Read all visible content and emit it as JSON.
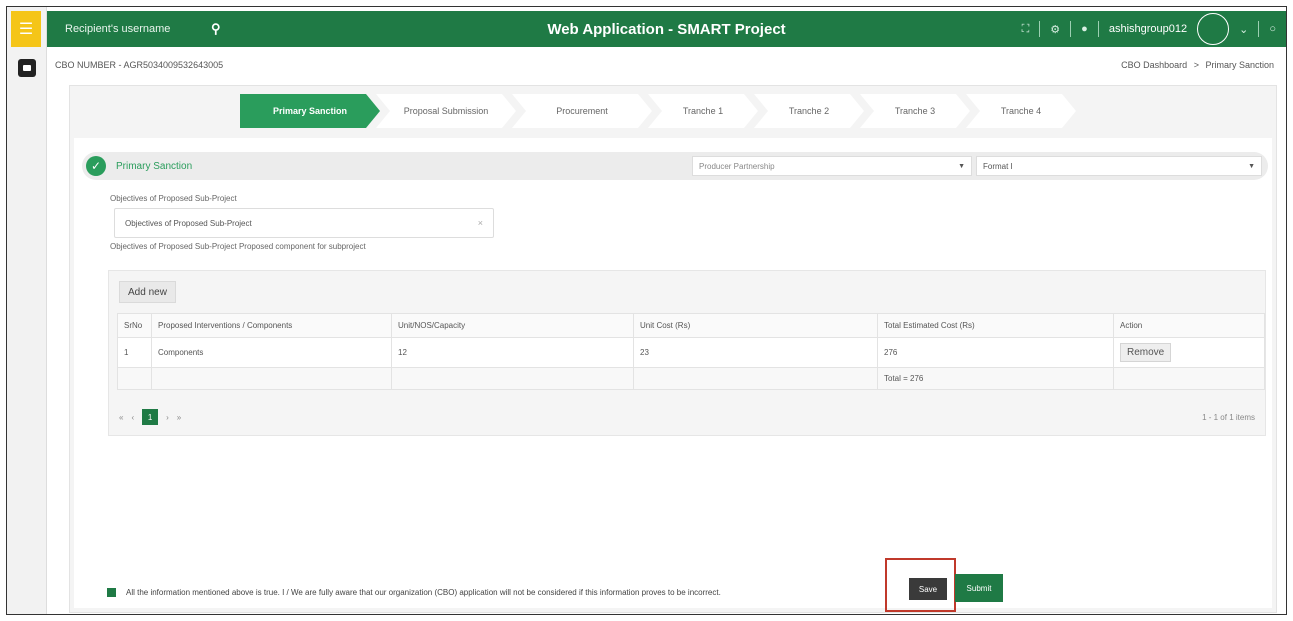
{
  "app": {
    "title": "Web Application - SMART Project"
  },
  "topbar": {
    "search_placeholder": "Recipient's username",
    "username": "ashishgroup012",
    "caret": "⌄",
    "icons": [
      "expand-icon",
      "gear-icon",
      "bell-icon",
      "power-icon"
    ]
  },
  "header": {
    "cbo_number": "CBO NUMBER - AGR5034009532643005",
    "breadcrumb": [
      "CBO Dashboard",
      "Primary Sanction"
    ],
    "breadcrumb_sep": ">"
  },
  "steps": [
    {
      "label": "Primary Sanction",
      "active": true
    },
    {
      "label": "Proposal Submission",
      "active": false
    },
    {
      "label": "Procurement",
      "active": false
    },
    {
      "label": "Tranche 1",
      "active": false
    },
    {
      "label": "Tranche 2",
      "active": false
    },
    {
      "label": "Tranche 3",
      "active": false
    },
    {
      "label": "Tranche 4",
      "active": false
    }
  ],
  "section": {
    "title": "Primary Sanction",
    "select1": "Producer Partnership",
    "select2": "Format I"
  },
  "objectives": {
    "label": "Objectives of Proposed Sub-Project",
    "value": "Objectives of Proposed Sub-Project",
    "clear": "×",
    "hint": "Objectives of Proposed Sub-Project Proposed component for subproject"
  },
  "grid": {
    "add_label": "Add new",
    "columns": [
      "SrNo",
      "Proposed Interventions / Components",
      "Unit/NOS/Capacity",
      "Unit Cost (Rs)",
      "Total Estimated Cost (Rs)",
      "Action"
    ],
    "rows": [
      {
        "srno": "1",
        "component": "Components",
        "units": "12",
        "unit_cost": "23",
        "total": "276",
        "action": "Remove"
      }
    ],
    "total_label": "Total = 276",
    "pager": {
      "first": "«",
      "prev": "‹",
      "current": "1",
      "next": "›",
      "last": "»"
    },
    "items_label": "1 - 1 of 1 items"
  },
  "footer": {
    "declaration": "All the information mentioned above is true. I / We are fully aware that our organization (CBO) application will not be considered if this information proves to be incorrect.",
    "save_label": "Save",
    "submit_label": "Submit"
  },
  "colors": {
    "brand": "#1f7a45",
    "accent": "#2a9d5c",
    "menu": "#f5c518",
    "highlight": "#c0392b"
  }
}
